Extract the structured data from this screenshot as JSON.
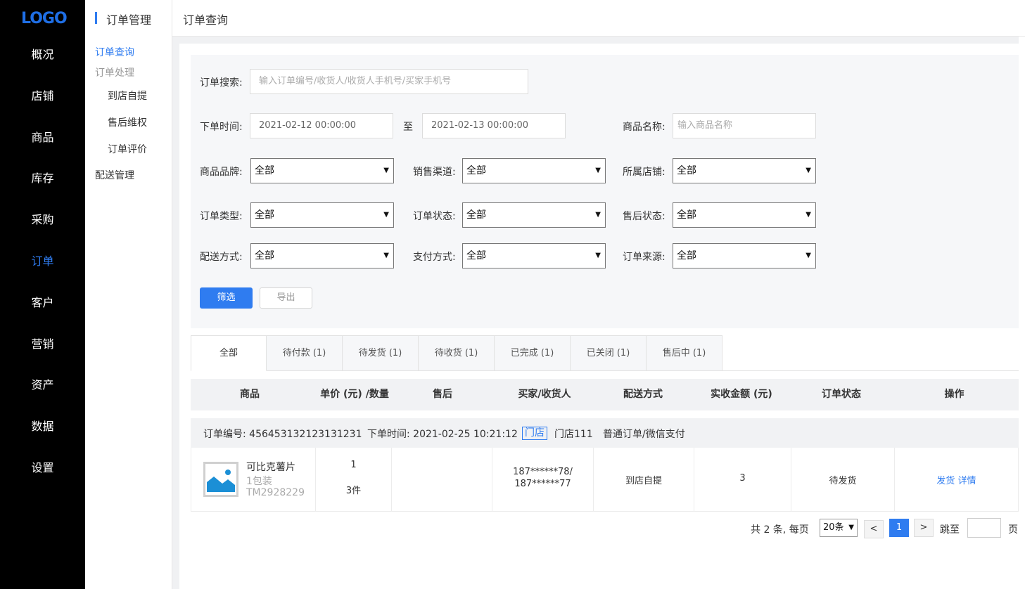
{
  "nav": {
    "logo": "LOGO",
    "items": [
      "概况",
      "店铺",
      "商品",
      "库存",
      "采购",
      "订单",
      "客户",
      "营销",
      "资产",
      "数据",
      "设置"
    ],
    "active": "订单"
  },
  "submenu": {
    "title": "订单管理",
    "items": [
      "订单查询",
      "订单处理",
      "到店自提",
      "售后维权",
      "订单评价",
      "配送管理"
    ]
  },
  "header": {
    "title": "订单查询"
  },
  "filter": {
    "search_label": "订单搜索:",
    "search_placeholder": "输入订单编号/收货人/收货人手机号/买家手机号",
    "time_label": "下单时间:",
    "time_start": "2021-02-12 00:00:00",
    "time_sep": "至",
    "time_end": "2021-02-13 00:00:00",
    "product_label": "商品名称:",
    "product_placeholder": "输入商品名称",
    "brand_label": "商品品牌:",
    "channel_label": "销售渠道:",
    "store_label": "所属店铺:",
    "type_label": "订单类型:",
    "status_label": "订单状态:",
    "aftersale_label": "售后状态:",
    "delivery_label": "配送方式:",
    "payment_label": "支付方式:",
    "source_label": "订单来源:",
    "option_all": "全部",
    "filter_button": "筛选",
    "export_button": "导出"
  },
  "tabs": [
    "全部",
    "待付款 (1)",
    "待发货 (1)",
    "待收货 (1)",
    "已完成 (1)",
    "已关闭 (1)",
    "售后中 (1)"
  ],
  "table": {
    "headers": [
      "商品",
      "单价 (元) /数量",
      "售后",
      "买家/收货人",
      "配送方式",
      "实收金额 (元)",
      "订单状态",
      "操作"
    ],
    "order": {
      "number": "订单编号: 456453132123131231",
      "time": "下单时间: 2021-02-25 10:21:12",
      "store_tag": "门店",
      "store": "门店111",
      "type": "普通订单/微信支付"
    },
    "row": {
      "product_name": "可比克薯片",
      "product_spec": "1包装",
      "product_sku": "TM2928229",
      "price": "1",
      "quantity": "3件",
      "aftersale": "",
      "buyer": "187******78/",
      "receiver": "187******77",
      "delivery": "到店自提",
      "amount": "3",
      "status": "待发货",
      "action_ship": "发货",
      "action_detail": "详情"
    }
  },
  "pagination": {
    "total": "共 2 条, 每页",
    "page_size": "20条",
    "prev": "<",
    "current": "1",
    "next": ">",
    "goto": "跳至",
    "page_suffix": "页"
  },
  "colors": {
    "accent": "#2f7cf0",
    "nav_bg": "#000000"
  }
}
